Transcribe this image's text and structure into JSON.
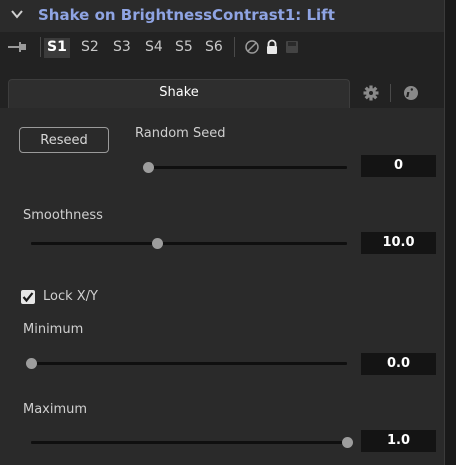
{
  "header": {
    "title": "Shake on BrightnessContrast1: Lift"
  },
  "versions": {
    "items": [
      "S1",
      "S2",
      "S3",
      "S4",
      "S5",
      "S6"
    ],
    "selected": "S1"
  },
  "tabs": {
    "main_label": "Shake"
  },
  "controls": {
    "reseed_label": "Reseed",
    "random_seed": {
      "label": "Random Seed",
      "value": "0",
      "level": 0.0
    },
    "smoothness": {
      "label": "Smoothness",
      "value": "10.0",
      "level": 0.4
    },
    "lock_xy": {
      "label": "Lock X/Y",
      "checked": true
    },
    "minimum": {
      "label": "Minimum",
      "value": "0.0",
      "level": 0.0
    },
    "maximum": {
      "label": "Maximum",
      "value": "1.0",
      "level": 1.0
    }
  },
  "colors": {
    "title": "#8fa4e3",
    "panel": "#2a2a2a",
    "value_box": "#141414"
  }
}
